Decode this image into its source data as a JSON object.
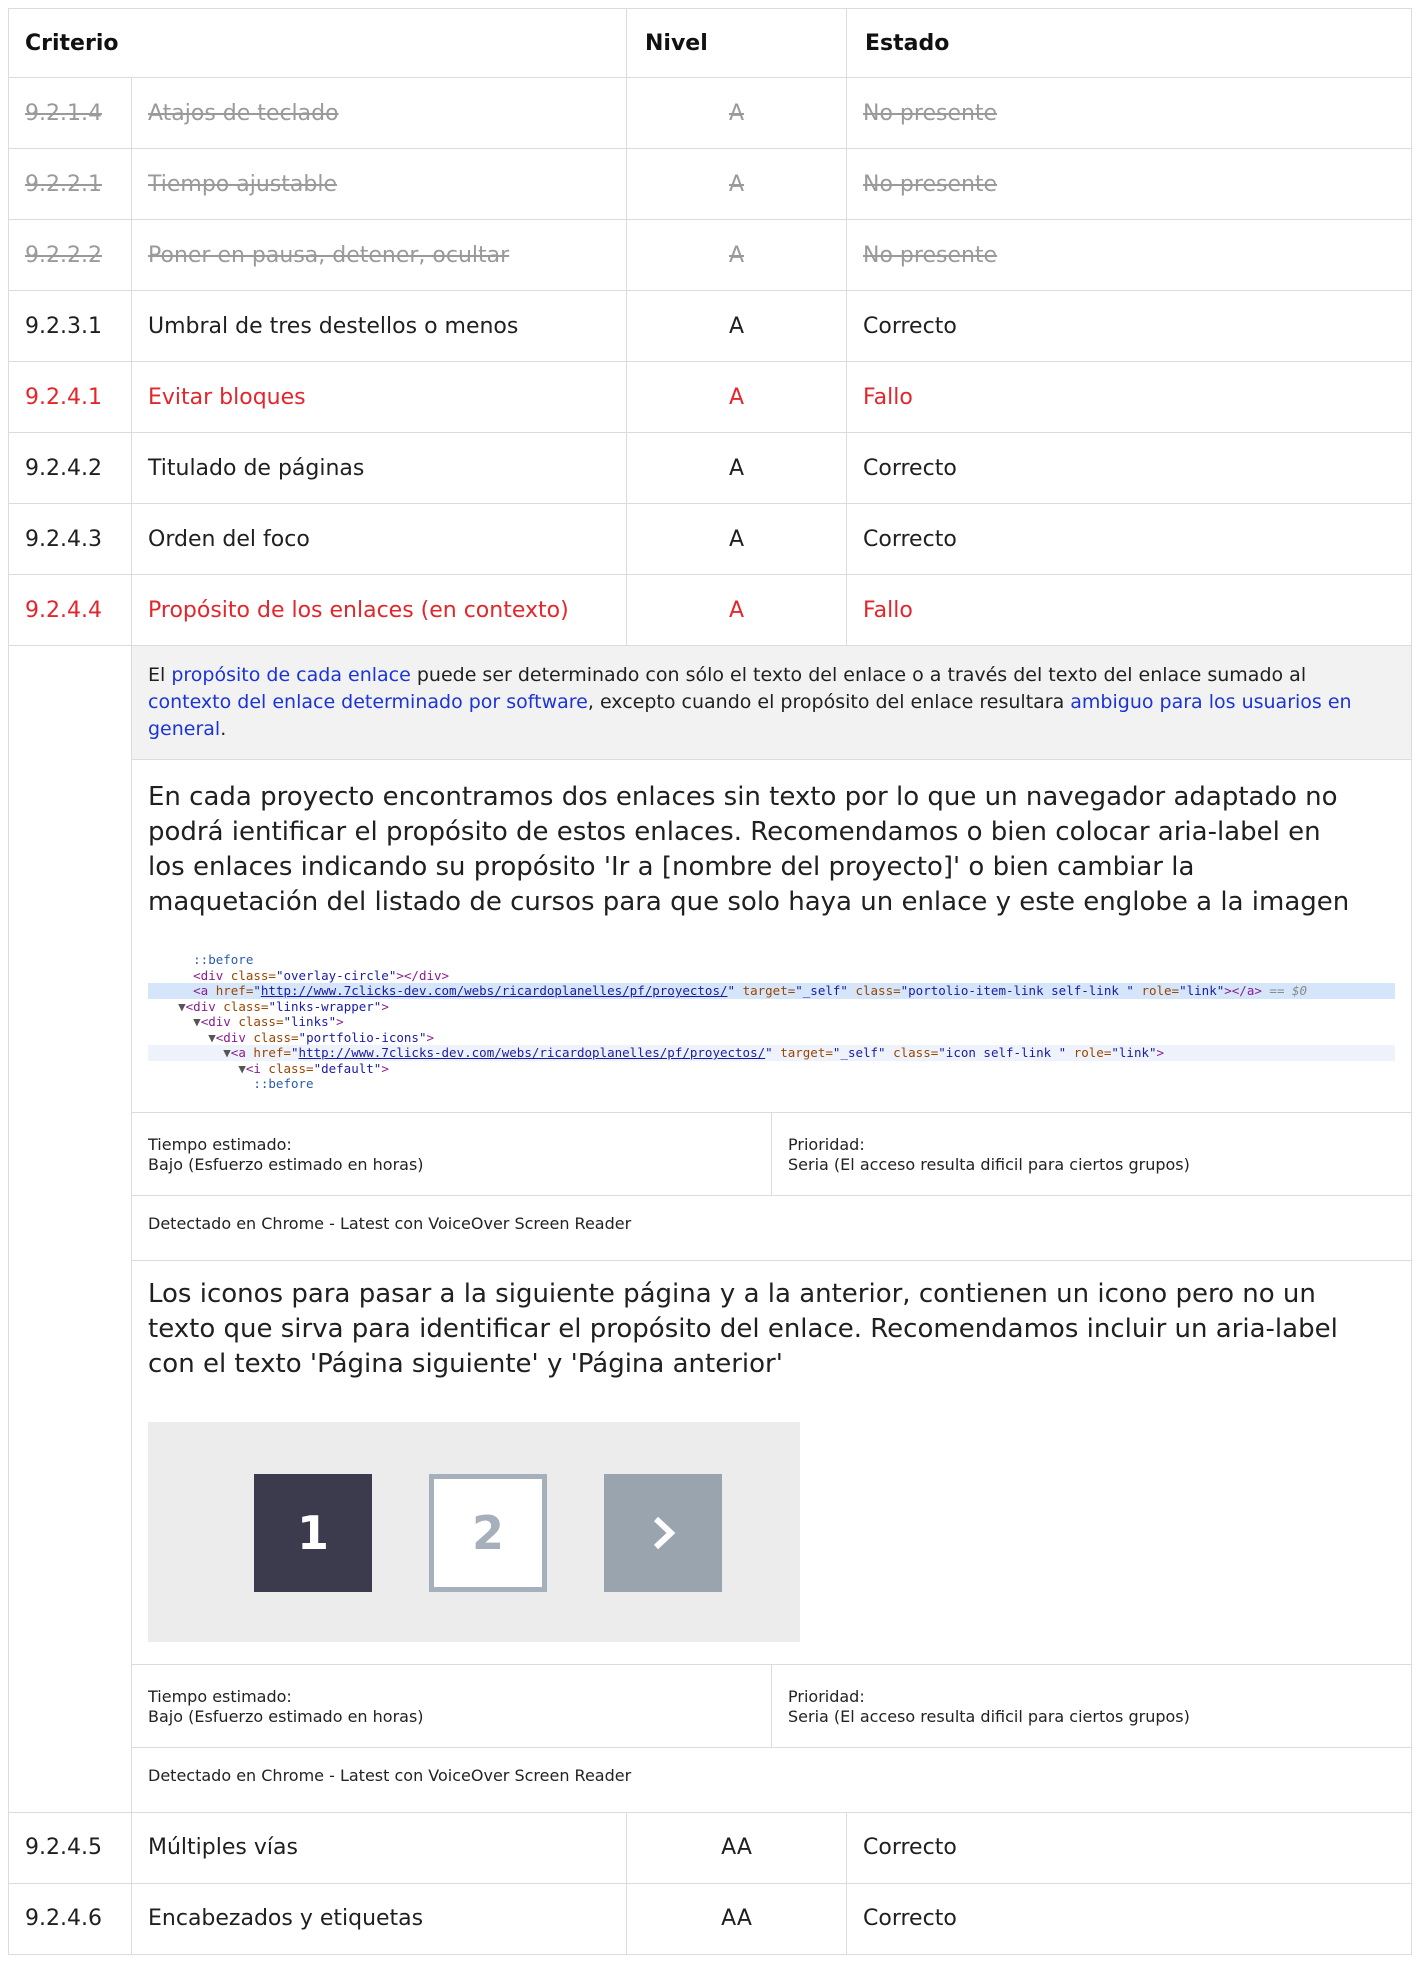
{
  "headers": {
    "criterio": "Criterio",
    "nivel": "Nivel",
    "estado": "Estado"
  },
  "rows": [
    {
      "num": "9.2.1.4",
      "name": "Atajos de teclado",
      "level": "A",
      "status": "No presente"
    },
    {
      "num": "9.2.2.1",
      "name": "Tiempo ajustable",
      "level": "A",
      "status": "No presente"
    },
    {
      "num": "9.2.2.2",
      "name": "Poner en pausa, detener, ocultar",
      "level": "A",
      "status": "No presente"
    },
    {
      "num": "9.2.3.1",
      "name": "Umbral de tres destellos o menos",
      "level": "A",
      "status": "Correcto"
    },
    {
      "num": "9.2.4.1",
      "name": "Evitar bloques",
      "level": "A",
      "status": "Fallo"
    },
    {
      "num": "9.2.4.2",
      "name": "Titulado de páginas",
      "level": "A",
      "status": "Correcto"
    },
    {
      "num": "9.2.4.3",
      "name": "Orden del foco",
      "level": "A",
      "status": "Correcto"
    },
    {
      "num": "9.2.4.4",
      "name": "Propósito de los enlaces (en contexto)",
      "level": "A",
      "status": "Fallo"
    }
  ],
  "detail": {
    "desc": {
      "t1": "El ",
      "l1": "propósito de cada enlace",
      "t2": " puede ser determinado con sólo el texto del enlace o a través del texto del enlace sumado al ",
      "l2": "contexto del enlace determinado por software",
      "t3": ", excepto cuando el propósito del enlace resultara ",
      "l3": "ambiguo para los usuarios en general",
      "t4": "."
    },
    "finding1": "En cada proyecto encontramos dos enlaces sin texto por lo que un navegador adaptado no podrá ientificar el propósito de estos enlaces. Recomendamos o bien colocar aria-label en los enlaces indicando su propósito 'Ir a [nombre del proyecto]' o bien cambiar la maquetación del listado de cursos para que solo haya un enlace y este englobe a la imagen",
    "code": {
      "before": "::before",
      "overlay_open": "<div ",
      "overlay_attr": "class=",
      "overlay_val": "\"overlay-circle\"",
      "overlay_close": "></div>",
      "href_url": "http://www.7clicks-dev.com/webs/ricardoplanelles/pf/proyectos/",
      "a1_class": "\"portolio-item-link self-link \"",
      "a1_end": "== $0",
      "links_wrapper": "\"links-wrapper\"",
      "links": "\"links\"",
      "portfolio_icons": "\"portfolio-icons\"",
      "a2_class": "\"icon self-link \"",
      "i_class": "\"default\"",
      "target": "\"_self\"",
      "role": "\"link\""
    },
    "meta1": {
      "tiempo_label": "Tiempo estimado:",
      "tiempo_value": "Bajo (Esfuerzo estimado en horas)",
      "prioridad_label": "Prioridad:",
      "prioridad_value": "Seria (El acceso resulta dificil para ciertos grupos)"
    },
    "detected1": "Detectado en Chrome - Latest con VoiceOver Screen Reader",
    "finding2": "Los iconos para pasar a la siguiente página y a la anterior, contienen un icono pero no un texto que sirva para identificar el propósito del enlace. Recomendamos incluir un aria-label con el texto 'Página siguiente' y 'Página anterior'",
    "pager": {
      "p1": "1",
      "p2": "2",
      "active_color": "#3c3a4d",
      "next_icon": "chevron-right-icon"
    },
    "meta2": {
      "tiempo_label": "Tiempo estimado:",
      "tiempo_value": "Bajo (Esfuerzo estimado en horas)",
      "prioridad_label": "Prioridad:",
      "prioridad_value": "Seria (El acceso resulta dificil para ciertos grupos)"
    },
    "detected2": "Detectado en Chrome - Latest con VoiceOver Screen Reader"
  },
  "rows_after": [
    {
      "num": "9.2.4.5",
      "name": "Múltiples vías",
      "level": "AA",
      "status": "Correcto"
    },
    {
      "num": "9.2.4.6",
      "name": "Encabezados y etiquetas",
      "level": "AA",
      "status": "Correcto"
    }
  ],
  "colors": {
    "fail": "#e3262b",
    "link": "#1a34d6",
    "na": "#9a9a9a"
  }
}
